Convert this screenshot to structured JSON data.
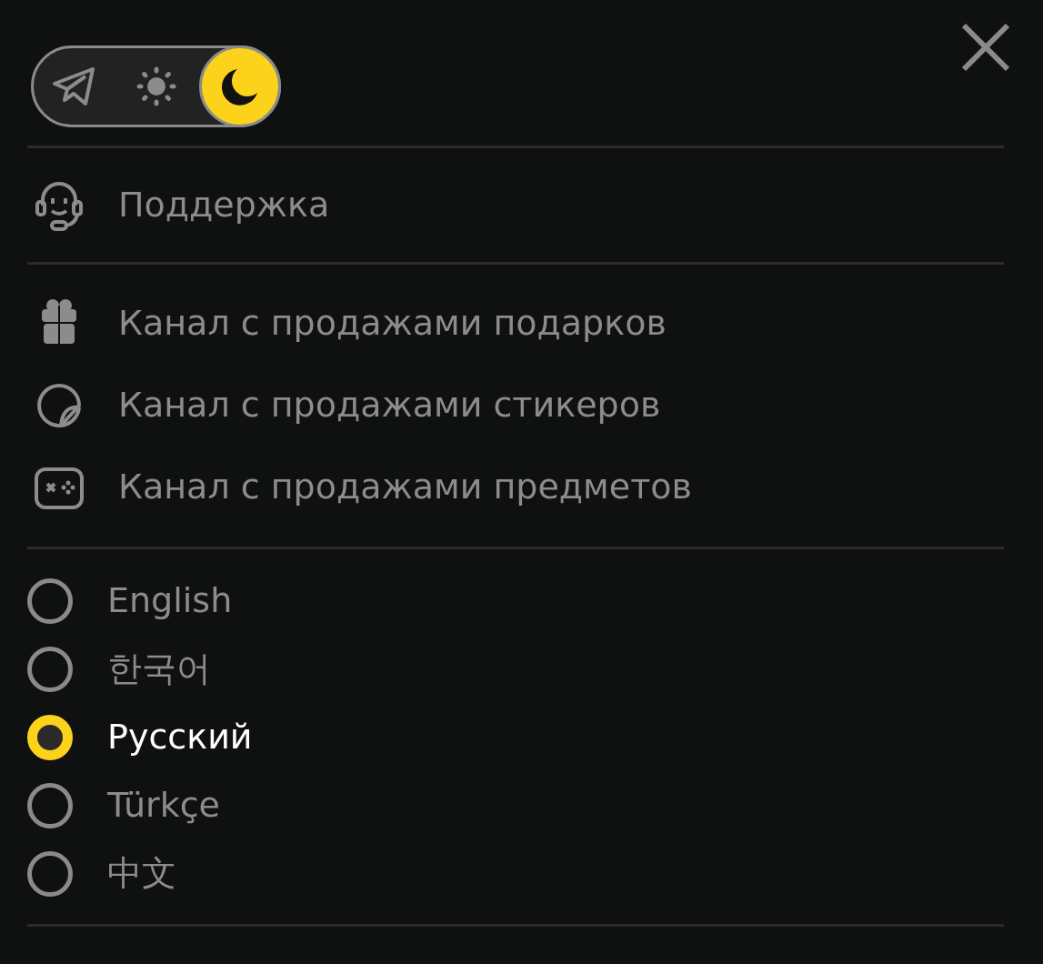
{
  "theme_toggle": {
    "dark": true
  },
  "support": {
    "label": "Поддержка"
  },
  "channels": [
    {
      "kind": "gift",
      "label": "Канал с продажами подарков"
    },
    {
      "kind": "sticker",
      "label": "Канал с продажами стикеров"
    },
    {
      "kind": "gamepad",
      "label": "Канал с продажами предметов"
    }
  ],
  "languages": [
    {
      "label": "English",
      "selected": false
    },
    {
      "label": "한국어",
      "selected": false
    },
    {
      "label": "Русский",
      "selected": true
    },
    {
      "label": "Türkçe",
      "selected": false
    },
    {
      "label": "中文",
      "selected": false
    }
  ]
}
